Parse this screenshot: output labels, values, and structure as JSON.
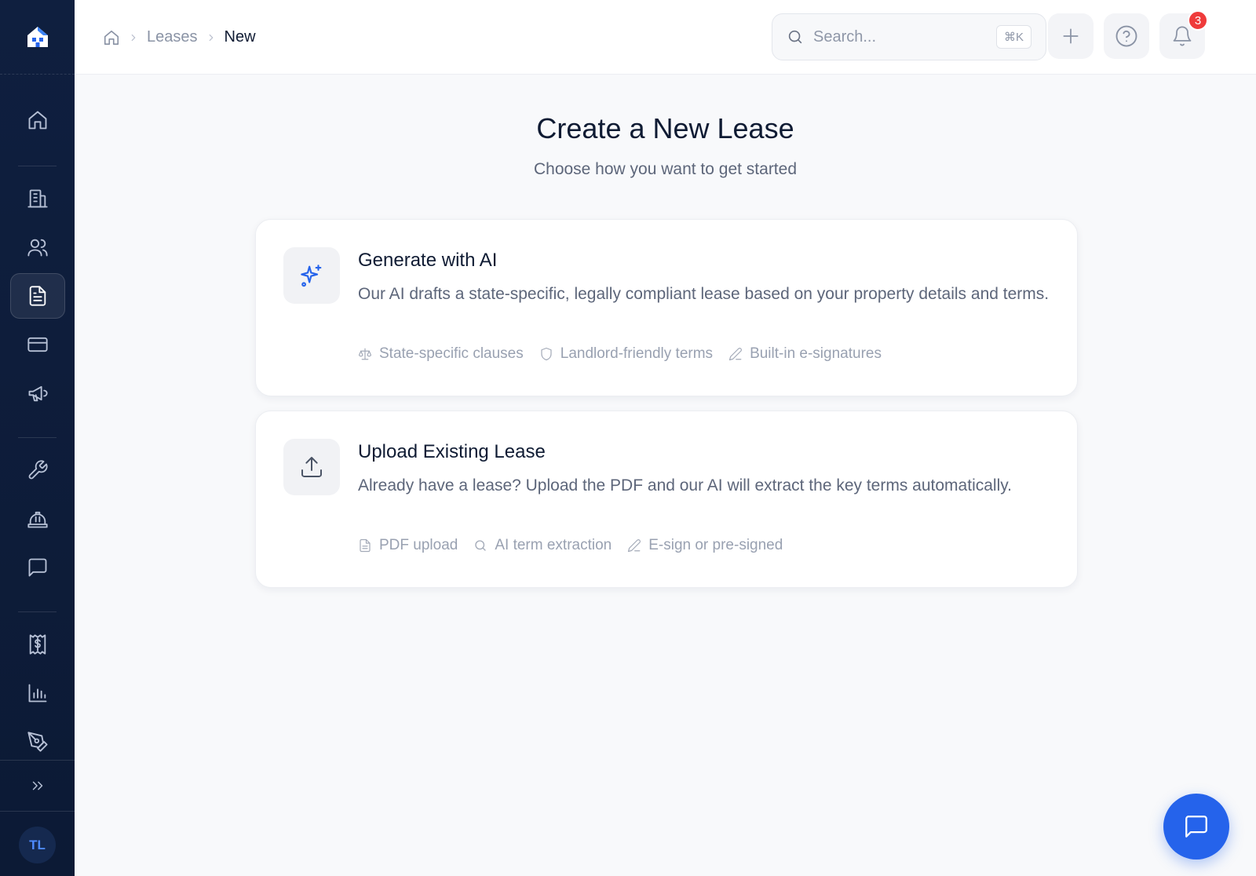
{
  "breadcrumb": {
    "items": [
      "Leases"
    ],
    "current": "New"
  },
  "search": {
    "placeholder": "Search...",
    "shortcut": "⌘K"
  },
  "notifications": {
    "count": "3"
  },
  "page": {
    "title": "Create a New Lease",
    "subtitle": "Choose how you want to get started"
  },
  "options": [
    {
      "title": "Generate with AI",
      "description": "Our AI drafts a state-specific, legally compliant lease based on your property details and terms.",
      "features": [
        "State-specific clauses",
        "Landlord-friendly terms",
        "Built-in e-signatures"
      ]
    },
    {
      "title": "Upload Existing Lease",
      "description": "Already have a lease? Upload the PDF and our AI will extract the key terms automatically.",
      "features": [
        "PDF upload",
        "AI term extraction",
        "E-sign or pre-signed"
      ]
    }
  ],
  "user": {
    "initials": "TL"
  },
  "colors": {
    "sidebar": "#0f1f3f",
    "accent": "#2563eb",
    "badge": "#ef3b3b"
  },
  "icons": {
    "sidebar": [
      "home-icon",
      "building-icon",
      "users-icon",
      "document-icon",
      "credit-card-icon",
      "megaphone-icon",
      "wrench-icon",
      "hard-hat-icon",
      "message-icon",
      "receipt-icon",
      "bar-chart-icon",
      "pen-tool-icon",
      "chevrons-right-icon"
    ]
  }
}
